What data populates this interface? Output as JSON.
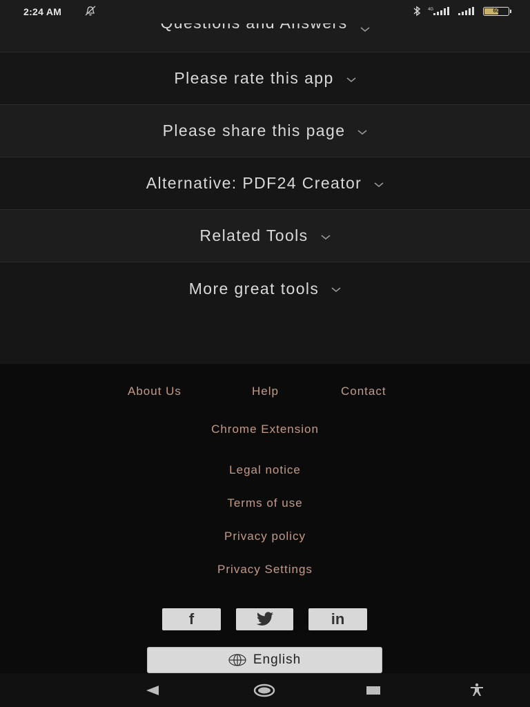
{
  "status": {
    "time": "2:24 AM",
    "battery": "60",
    "battery_level": 0.6
  },
  "accordion": [
    {
      "label": "Questions and Answers"
    },
    {
      "label": "Please rate this app"
    },
    {
      "label": "Please share this page"
    },
    {
      "label": "Alternative: PDF24 Creator"
    },
    {
      "label": "Related Tools"
    },
    {
      "label": "More great tools"
    }
  ],
  "footer": {
    "links": {
      "about": "About Us",
      "help": "Help",
      "contact": "Contact",
      "chrome": "Chrome Extension",
      "legal": "Legal notice",
      "terms": "Terms of use",
      "privacy": "Privacy policy",
      "privacy_settings": "Privacy Settings"
    },
    "socials": {
      "facebook": "f",
      "linkedin": "in"
    },
    "language": "English"
  },
  "colors": {
    "link": "#c49a86",
    "background": "#0b0b0b",
    "panel": "#1a1a1a",
    "button": "#d8d8d8"
  }
}
